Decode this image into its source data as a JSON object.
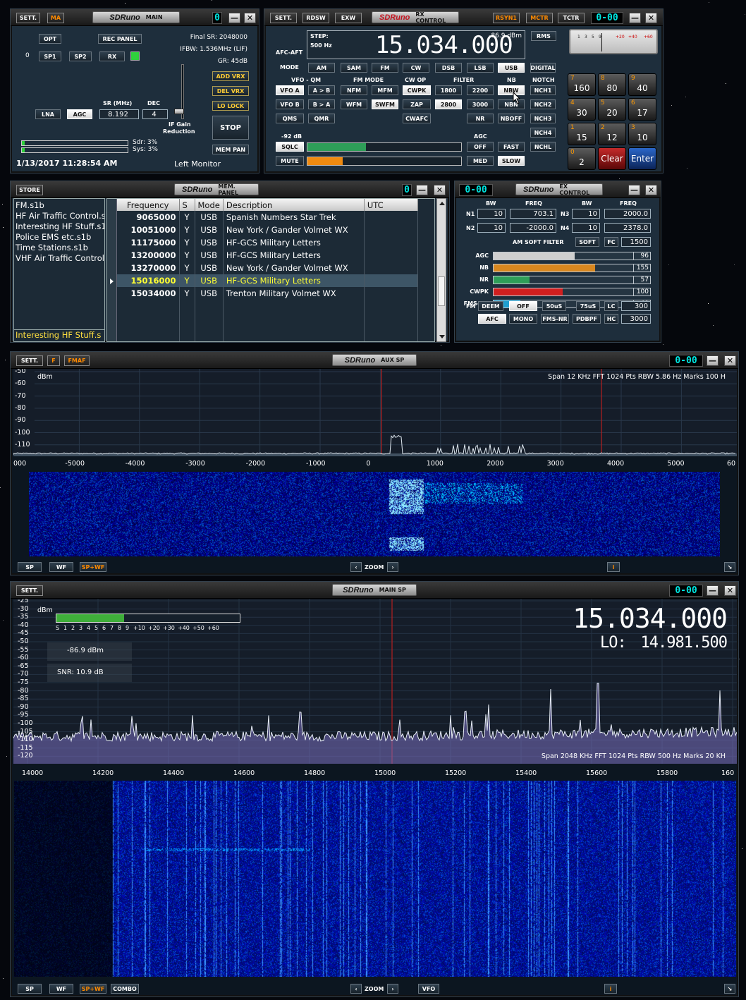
{
  "main": {
    "title_logo": "SDRuno",
    "title": "MAIN",
    "sett": "SETT.",
    "ma": "MA",
    "seg": "0",
    "close": "✕",
    "minimize": "—",
    "opt": "OPT",
    "rec_panel": "REC PANEL",
    "sp1": "SP1",
    "sp2": "SP2",
    "rx": "RX",
    "rx_index": "0",
    "final_sr": "Final SR: 2048000",
    "ifbw": "IFBW: 1.536MHz (LIF)",
    "gr": "GR: 45dB",
    "add_vrx": "ADD VRX",
    "del_vrx": "DEL VRX",
    "lo_lock": "LO LOCK",
    "stop": "STOP",
    "mem_pan": "MEM PAN",
    "sr_label": "SR (MHz)",
    "dec_label": "DEC",
    "lna": "LNA",
    "agc": "AGC",
    "sr_value": "8.192",
    "dec_value": "4",
    "if_gain": "IF Gain",
    "reduction": "Reduction",
    "sdr": "Sdr: 3%",
    "sys": "Sys: 3%",
    "datetime": "1/13/2017 11:28:54 AM",
    "monitor": "Left Monitor"
  },
  "rx": {
    "title_logo": "SDRuno",
    "title": "RX CONTROL",
    "sett": "SETT.",
    "rdsw": "RDSW",
    "exw": "EXW",
    "rsyn": "RSYN1",
    "mctr": "MCTR",
    "tctr": "TCTR",
    "seg": "0-00",
    "step_label": "STEP:",
    "step_value": "500 Hz",
    "frequency": "15.034.000",
    "level": "-86.9 dBm",
    "rms": "RMS",
    "afc_aft": "AFC-AFT",
    "mode_label": "MODE",
    "modes": [
      "AM",
      "SAM",
      "FM",
      "CW",
      "DSB",
      "LSB",
      "USB",
      "DIGITAL"
    ],
    "vfo_qm": "VFO - QM",
    "fm_mode": "FM MODE",
    "cw_op": "CW OP",
    "filter": "FILTER",
    "nb": "NB",
    "notch": "NOTCH",
    "vfo_a": "VFO A",
    "a_b": "A > B",
    "nfm": "NFM",
    "mfm": "MFM",
    "cwpk": "CWPK",
    "f1800": "1800",
    "f2200": "2200",
    "nbw": "NBW",
    "nch1": "NCH1",
    "vfo_b": "VFO B",
    "b_a": "B > A",
    "wfm": "WFM",
    "swfm": "SWFM",
    "zap": "ZAP",
    "f2800": "2800",
    "f3000": "3000",
    "nbn": "NBN",
    "nch2": "NCH2",
    "qms": "QMS",
    "qmr": "QMR",
    "cwafc": "CWAFC",
    "nr": "NR",
    "nboff": "NBOFF",
    "nch3": "NCH3",
    "nch4": "NCH4",
    "nchl": "NCHL",
    "sql_level": "-92 dB",
    "agc_label": "AGC",
    "sqlc": "SQLC",
    "off": "OFF",
    "fast": "FAST",
    "mute": "MUTE",
    "med": "MED",
    "slow": "SLOW",
    "keys": [
      {
        "n": "7",
        "t": "160"
      },
      {
        "n": "8",
        "t": "80"
      },
      {
        "n": "9",
        "t": "40"
      },
      {
        "n": "4",
        "t": "30"
      },
      {
        "n": "5",
        "t": "20"
      },
      {
        "n": "6",
        "t": "17"
      },
      {
        "n": "1",
        "t": "15"
      },
      {
        "n": "2",
        "t": "12"
      },
      {
        "n": "3",
        "t": "10"
      },
      {
        "n": "0",
        "t": "2"
      },
      {
        "n": "",
        "t": "Clear"
      },
      {
        "n": "",
        "t": "Enter"
      }
    ],
    "meter": [
      "1",
      "3",
      "5",
      "9",
      "+20",
      "+40",
      "+60"
    ]
  },
  "mem": {
    "title_logo": "SDRuno",
    "title": "MEM. PANEL",
    "store": "STORE",
    "seg": "0",
    "files": [
      "FM.s1b",
      "HF Air Traffic Control.s1b",
      "Interesting HF Stuff.s1b",
      "Police EMS etc.s1b",
      "Time Stations.s1b",
      "VHF Air Traffic Control.s1b"
    ],
    "selected_file": "Interesting HF Stuff.s",
    "headers": [
      "Frequency",
      "S",
      "Mode",
      "Description",
      "UTC"
    ],
    "rows": [
      [
        "9065000",
        "Y",
        "USB",
        "Spanish Numbers Star Trek",
        ""
      ],
      [
        "10051000",
        "Y",
        "USB",
        "New York / Gander Volmet WX",
        ""
      ],
      [
        "11175000",
        "Y",
        "USB",
        "HF-GCS Military Letters",
        ""
      ],
      [
        "13200000",
        "Y",
        "USB",
        "HF-GCS Military Letters",
        ""
      ],
      [
        "13270000",
        "Y",
        "USB",
        "New York / Gander Volmet WX",
        ""
      ],
      [
        "15016000",
        "Y",
        "USB",
        "HF-GCS Military Letters",
        ""
      ],
      [
        "15034000",
        "Y",
        "USB",
        "Trenton Military Volmet WX",
        ""
      ]
    ]
  },
  "ex": {
    "title_logo": "SDRuno",
    "title": "EX CONTROL",
    "seg": "0-00",
    "bw": "BW",
    "freq": "FREQ",
    "n1": "N1",
    "n1_bw": "10",
    "n1_freq": "703.1",
    "n3": "N3",
    "n3_bw": "10",
    "n3_freq": "2000.0",
    "n2": "N2",
    "n2_bw": "10",
    "n2_freq": "-2000.0",
    "n4": "N4",
    "n4_bw": "10",
    "n4_freq": "2378.0",
    "am_soft": "AM SOFT FILTER",
    "soft": "SOFT",
    "fc": "FC",
    "fc_value": "1500",
    "bars": [
      {
        "name": "AGC",
        "value": "96",
        "pct": 0.52,
        "color": "#cfcfcf"
      },
      {
        "name": "NB",
        "value": "155",
        "pct": 0.65,
        "color": "#d8871f"
      },
      {
        "name": "NR",
        "value": "57",
        "pct": 0.23,
        "color": "#2e9e58"
      },
      {
        "name": "CWPK",
        "value": "100",
        "pct": 0.44,
        "color": "#d21f1f"
      },
      {
        "name": "FMS-NR",
        "value": "40",
        "pct": 0.17,
        "color": "#1f9fd0"
      }
    ],
    "fm": "FM",
    "deem": "DEEM",
    "off": "OFF",
    "s50": "50uS",
    "s75": "75uS",
    "lc": "LC",
    "lc_value": "300",
    "afc": "AFC",
    "mono": "MONO",
    "fms_nr": "FMS-NR",
    "pdbpf": "PDBPF",
    "hc": "HC",
    "hc_value": "3000"
  },
  "aux": {
    "title_logo": "SDRuno",
    "title": "AUX SP",
    "sett": "SETT.",
    "f": "F",
    "fmaf": "FMAF",
    "seg": "0-00",
    "unit": "dBm",
    "yticks": [
      "-50",
      "-60",
      "-70",
      "-80",
      "-90",
      "-100",
      "-110"
    ],
    "info": "Span 12 KHz   FFT 1024 Pts   RBW 5.86 Hz   Marks 100 H",
    "xticks": [
      "000",
      "-5000",
      "-4000",
      "-3000",
      "-2000",
      "-1000",
      "0",
      "1000",
      "2000",
      "3000",
      "4000",
      "5000",
      "60"
    ],
    "sp": "SP",
    "wf": "WF",
    "spwf": "SP+WF",
    "zoom": "ZOOM",
    "i": "i"
  },
  "mainsp": {
    "title_logo": "SDRuno",
    "title": "MAIN SP",
    "sett": "SETT.",
    "seg": "0-00",
    "unit": "dBm",
    "yticks": [
      "-25",
      "-30",
      "-35",
      "-40",
      "-45",
      "-50",
      "-55",
      "-60",
      "-65",
      "-70",
      "-75",
      "-80",
      "-85",
      "-90",
      "-95",
      "-100",
      "-105",
      "-110",
      "-115",
      "-120"
    ],
    "smeter": [
      "S",
      "1",
      "2",
      "3",
      "4",
      "5",
      "6",
      "7",
      "8",
      "9",
      "+10",
      "+20",
      "+30",
      "+40",
      "+50",
      "+60"
    ],
    "level": "-86.9 dBm",
    "snr": "SNR: 10.9 dB",
    "frequency": "15.034.000",
    "lo_label": "LO:",
    "lo": "14.981.500",
    "info": "Span 2048 KHz   FFT 1024 Pts   RBW 500 Hz   Marks 20 KH",
    "xticks": [
      "14000",
      "14200",
      "14400",
      "14600",
      "14800",
      "15000",
      "15200",
      "15400",
      "15600",
      "15800",
      "160"
    ],
    "sp": "SP",
    "wf": "WF",
    "spwf": "SP+WF",
    "combo": "COMBO",
    "zoom": "ZOOM",
    "vfo": "VFO",
    "i": "i"
  },
  "colors": {
    "panel": "#1e2e3c",
    "accent": "#00e5e0",
    "highlight": "#ffff33",
    "wf_dark": "#000a66"
  }
}
